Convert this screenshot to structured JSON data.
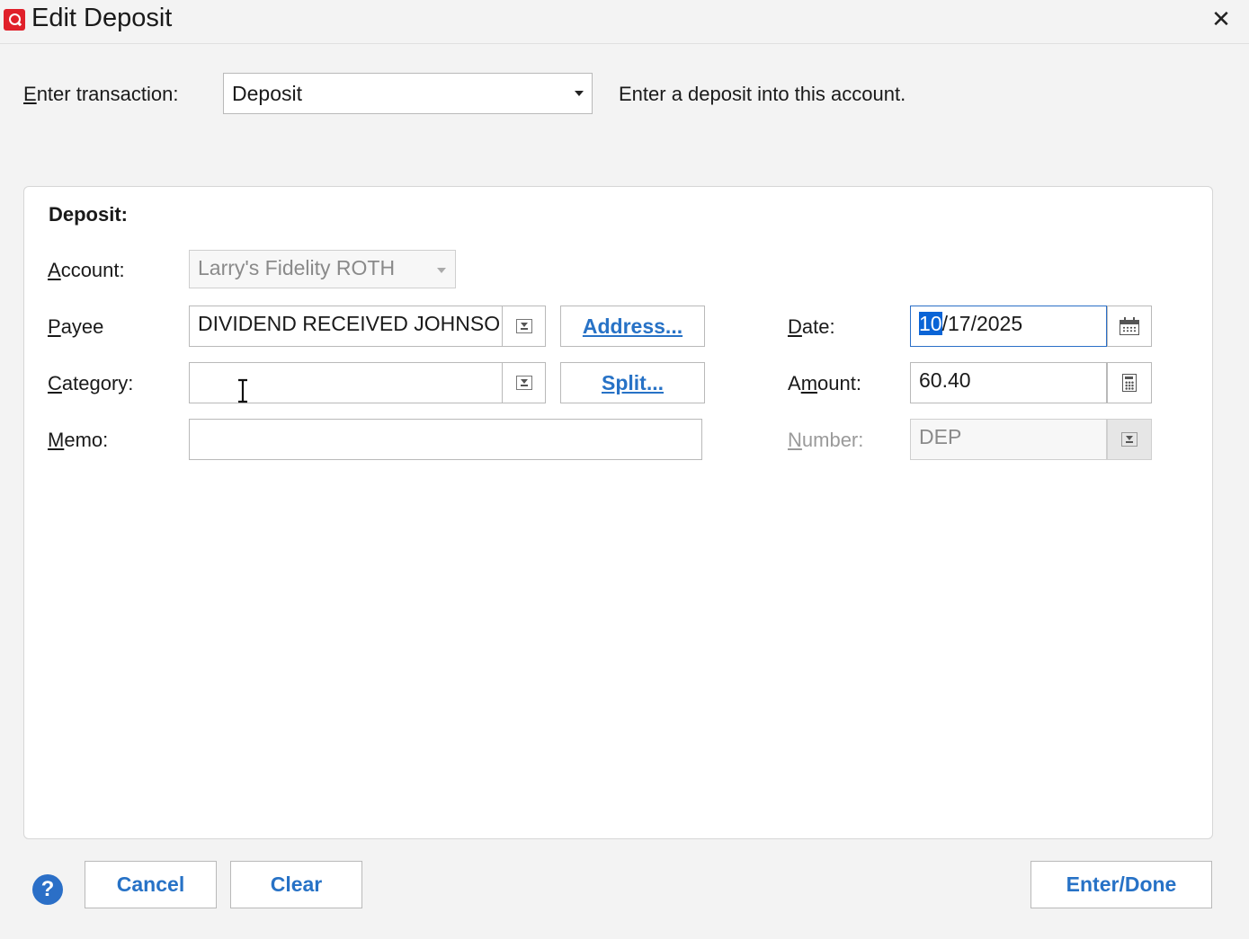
{
  "window": {
    "title": "Edit Deposit",
    "close_glyph": "✕"
  },
  "transaction": {
    "label": "Enter transaction:",
    "type": "Deposit",
    "description": "Enter a deposit into this account."
  },
  "section_title": "Deposit:",
  "fields": {
    "account_label": "Account:",
    "account_value": "Larry's Fidelity ROTH",
    "payee_label": "Payee",
    "payee_value": "DIVIDEND RECEIVED JOHNSON",
    "category_label": "Category:",
    "category_value": "",
    "memo_label": "Memo:",
    "memo_value": "",
    "date_label": "Date:",
    "date_selected_part": "10",
    "date_rest": "/17/2025",
    "amount_label": "Amount:",
    "amount_value": "60.40",
    "number_label": "Number:",
    "number_value": "DEP"
  },
  "buttons": {
    "address": "Address...",
    "split": "Split...",
    "cancel": "Cancel",
    "clear": "Clear",
    "enter_done": "Enter/Done",
    "help": "?"
  },
  "icons": {
    "app": "quicken-logo-icon",
    "dropdown": "chevron-down-icon",
    "list": "list-picker-icon",
    "calendar": "calendar-icon",
    "calculator": "calculator-icon",
    "help": "help-icon",
    "cursor": "text-cursor-icon"
  },
  "colors": {
    "accent": "#2772c6",
    "selection": "#0a64d6",
    "brand": "#e0202a"
  }
}
